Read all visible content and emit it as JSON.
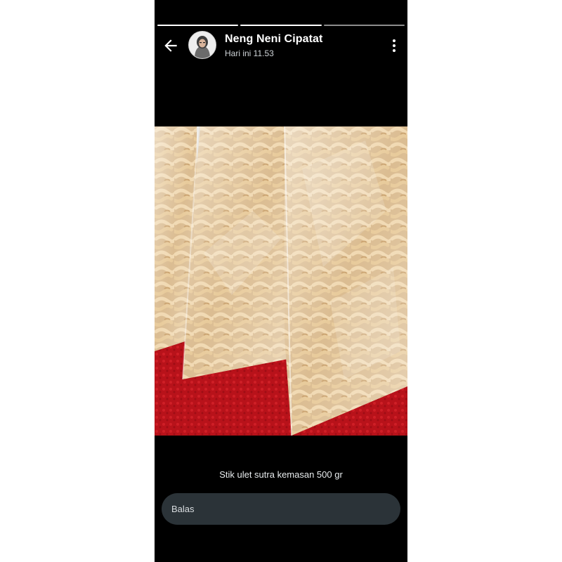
{
  "status": {
    "segments_total": 3,
    "segments_viewed": 2
  },
  "header": {
    "contact_name": "Neng Neni Cipatat",
    "timestamp": "Hari ini 11.53",
    "back_icon": "arrow-left-icon",
    "menu_icon": "more-vertical-icon"
  },
  "story": {
    "caption": "Stik ulet sutra kemasan 500 gr",
    "image_subject": "bags of fried stik ulet sutra snack on red cloth"
  },
  "reply": {
    "placeholder": "Balas"
  },
  "colors": {
    "background": "#000000",
    "reply_field": "#2b3338",
    "text": "#ffffff"
  }
}
